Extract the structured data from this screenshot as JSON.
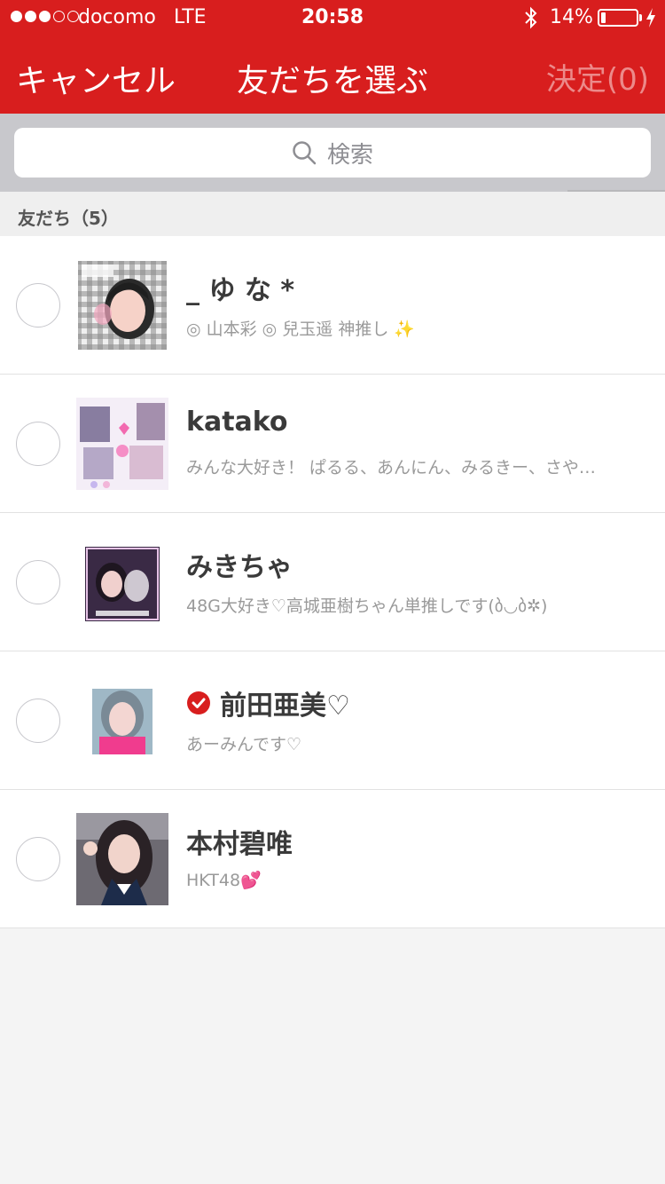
{
  "status_bar": {
    "carrier": "docomo",
    "network": "LTE",
    "time": "20:58",
    "battery": "14%",
    "battery_level": 0.14
  },
  "nav": {
    "cancel": "キャンセル",
    "title": "友だちを選ぶ",
    "confirm": "決定(0)"
  },
  "search": {
    "placeholder": "検索"
  },
  "section": {
    "label": "友だち（5）"
  },
  "friends": [
    {
      "name": "_ ゆ な *",
      "status": "◎ 山本彩 ◎ 兒玉遥  神推し ✨",
      "verified": false
    },
    {
      "name": "katako",
      "status": "みんな大好き！ ぱるる、あんにん、みるきー、さや…",
      "verified": false
    },
    {
      "name": "みきちゃ",
      "status": "48G大好き♡高城亜樹ちゃん単推しです(ბ◡ბ✲)",
      "verified": false
    },
    {
      "name": "前田亜美♡",
      "status": "あーみんです♡",
      "verified": true
    },
    {
      "name": "本村碧唯",
      "status": "HKT48💕",
      "verified": false
    }
  ],
  "colors": {
    "brand_red": "#d81e1e",
    "confirm_disabled": "#ec8a8a"
  }
}
